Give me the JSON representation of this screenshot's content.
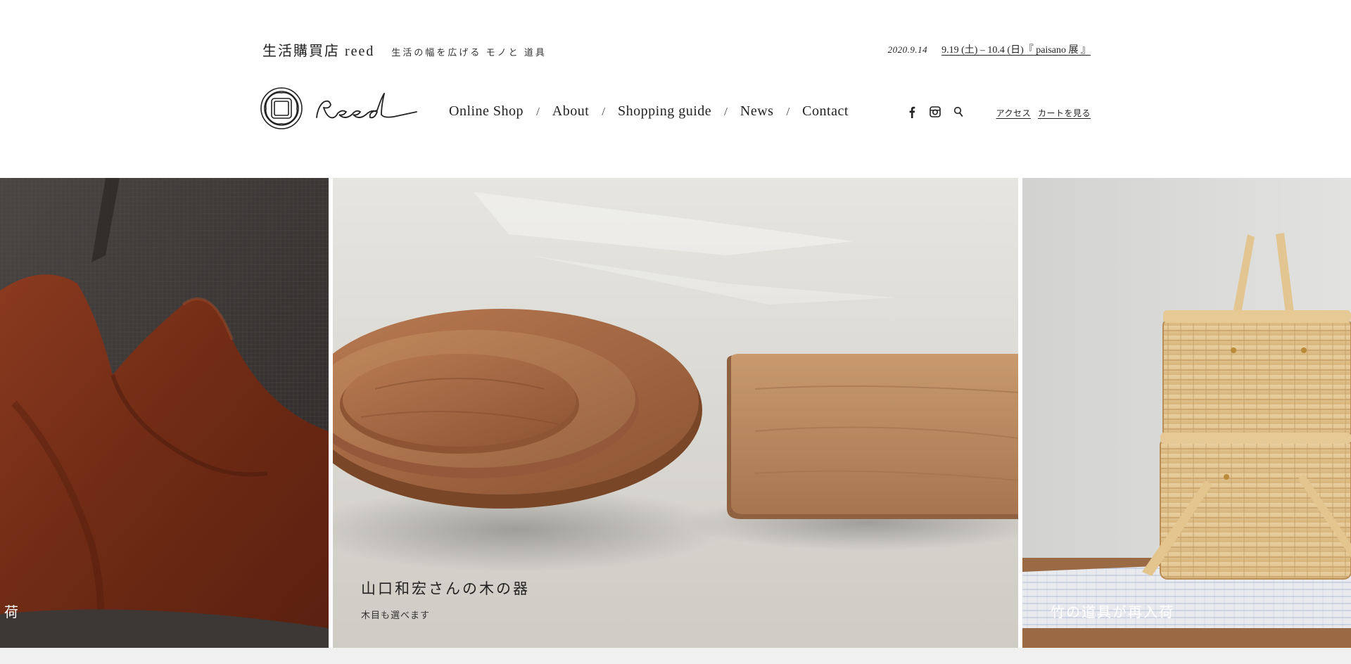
{
  "header": {
    "brand_name": "生活購買店 reed",
    "brand_tagline": "生活の幅を広げる モノと 道具",
    "news_date": "2020.9.14",
    "news_link": "9.19 (土) – 10.4 (日)『 paisano 展 』",
    "logo_text": "reed"
  },
  "nav": {
    "items": [
      {
        "label": "Online Shop"
      },
      {
        "label": "About"
      },
      {
        "label": "Shopping guide"
      },
      {
        "label": "News"
      },
      {
        "label": "Contact"
      }
    ],
    "separator": "/"
  },
  "social": {
    "icons": [
      "facebook-icon",
      "instagram-icon",
      "search-icon"
    ]
  },
  "util": {
    "access": "アクセス",
    "cart": "カートを見る"
  },
  "slides": {
    "left": {
      "caption": "荷"
    },
    "center": {
      "title": "山口和宏さんの木の器",
      "subtitle": "木目も選べます"
    },
    "right": {
      "caption": "竹の道具が再入荷"
    }
  },
  "colors": {
    "text": "#222222",
    "background": "#ffffff",
    "blanket": "#7a2e17",
    "wood": "#a86a42",
    "bamboo": "#e3c68f"
  }
}
